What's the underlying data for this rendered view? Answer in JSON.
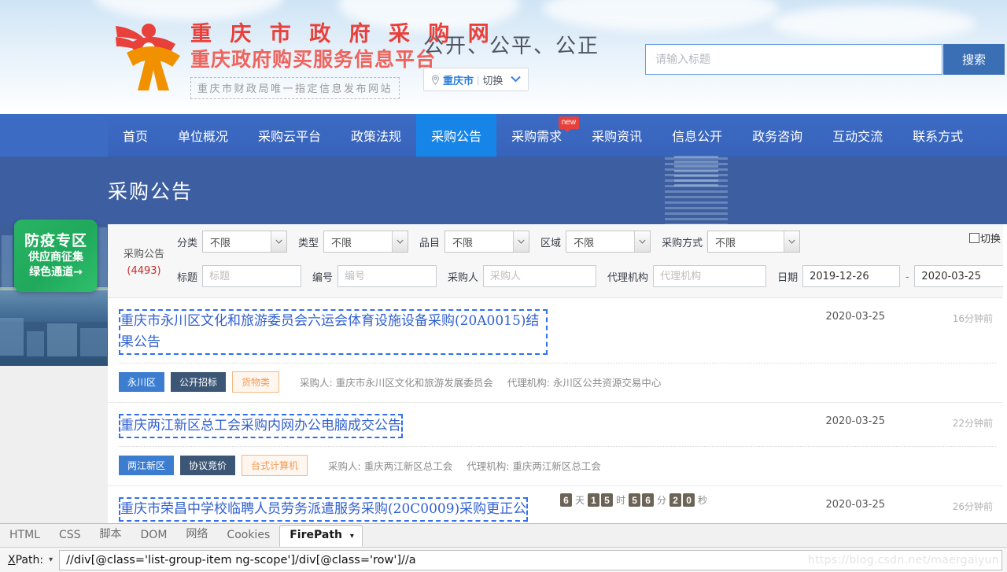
{
  "header": {
    "logo_line1": "重 庆 市 政 府 采 购 网",
    "logo_line2": "重庆政府购买服务信息平台",
    "logo_line3": "重庆市财政局唯一指定信息发布网站",
    "slogan": "公开、公平、公正",
    "city": {
      "icon": "location-pin-icon",
      "name": "重庆市",
      "divider": "|",
      "switch_label": "切换",
      "chevron": "chevron-down-icon"
    },
    "search": {
      "placeholder": "请输入标题",
      "value": "",
      "button_label": "搜索",
      "icon": "search-icon"
    }
  },
  "nav": {
    "items": [
      {
        "label": "首页",
        "active": false
      },
      {
        "label": "单位概况",
        "active": false
      },
      {
        "label": "采购云平台",
        "active": false
      },
      {
        "label": "政策法规",
        "active": false
      },
      {
        "label": "采购公告",
        "active": true
      },
      {
        "label": "采购需求",
        "active": false,
        "badge": "new"
      },
      {
        "label": "采购资讯",
        "active": false
      },
      {
        "label": "信息公开",
        "active": false
      },
      {
        "label": "政务咨询",
        "active": false
      },
      {
        "label": "互动交流",
        "active": false
      },
      {
        "label": "联系方式",
        "active": false
      }
    ]
  },
  "banner": {
    "title": "采购公告"
  },
  "epidemic_badge": {
    "line1": "防疫专区",
    "line2": "供应商征集",
    "line3": "绿色通道→"
  },
  "filter": {
    "panel_title": "采购公告",
    "panel_count": "(4493)",
    "selects": [
      {
        "label": "分类",
        "value": "不限"
      },
      {
        "label": "类型",
        "value": "不限"
      },
      {
        "label": "品目",
        "value": "不限"
      },
      {
        "label": "区域",
        "value": "不限"
      },
      {
        "label": "采购方式",
        "value": "不限"
      }
    ],
    "inputs": [
      {
        "label": "标题",
        "placeholder": "标题",
        "value": ""
      },
      {
        "label": "编号",
        "placeholder": "编号",
        "value": ""
      },
      {
        "label": "采购人",
        "placeholder": "采购人",
        "value": ""
      },
      {
        "label": "代理机构",
        "placeholder": "代理机构",
        "value": ""
      }
    ],
    "date": {
      "label": "日期",
      "from": "2019-12-26",
      "dash": "-",
      "to": "2020-03-25"
    },
    "switch_checkbox": {
      "label": "切换",
      "checked": false
    }
  },
  "list": [
    {
      "title": "重庆市永川区文化和旅游委员会六运会体育设施设备采购(20A0015)结果公告",
      "date": "2020-03-25",
      "ago": "16分钟前",
      "tag_region": "永川区",
      "tag_method": "公开招标",
      "tag_category": "货物类",
      "buyer": "采购人: 重庆市永川区文化和旅游发展委员会",
      "agency": "代理机构: 永川区公共资源交易中心"
    },
    {
      "title": "重庆两江新区总工会采购内网办公电脑成交公告",
      "date": "2020-03-25",
      "ago": "22分钟前",
      "tag_region": "两江新区",
      "tag_method": "协议竞价",
      "tag_category": "台式计算机",
      "buyer": "采购人: 重庆两江新区总工会",
      "agency": "代理机构: 重庆两江新区总工会"
    },
    {
      "title": "重庆市荣昌中学校临聘人员劳务派遣服务采购(20C0009)采购更正公",
      "date": "2020-03-25",
      "ago": "26分钟前",
      "tag_region": "",
      "tag_method": "",
      "tag_category": "",
      "buyer": "",
      "agency": ""
    }
  ],
  "countdown": {
    "d1": "6",
    "unit_day": "天",
    "h1": "1",
    "h2": "5",
    "unit_hour": "时",
    "m1": "5",
    "m2": "6",
    "unit_min": "分",
    "s1": "2",
    "s2": "0",
    "unit_sec": "秒"
  },
  "devtools": {
    "tabs": [
      {
        "label": "HTML",
        "active": false
      },
      {
        "label": "CSS",
        "active": false
      },
      {
        "label": "脚本",
        "active": false
      },
      {
        "label": "DOM",
        "active": false
      },
      {
        "label": "网络",
        "active": false
      },
      {
        "label": "Cookies",
        "active": false
      },
      {
        "label": "FirePath",
        "active": true,
        "caret": "▾"
      }
    ],
    "xpath_label": "XPath:",
    "xpath_caret": "▾",
    "xpath_value": "//div[@class='list-group-item ng-scope']/div[@class='row']//a"
  },
  "watermark": "https://blog.csdn.net/maergaiyun"
}
